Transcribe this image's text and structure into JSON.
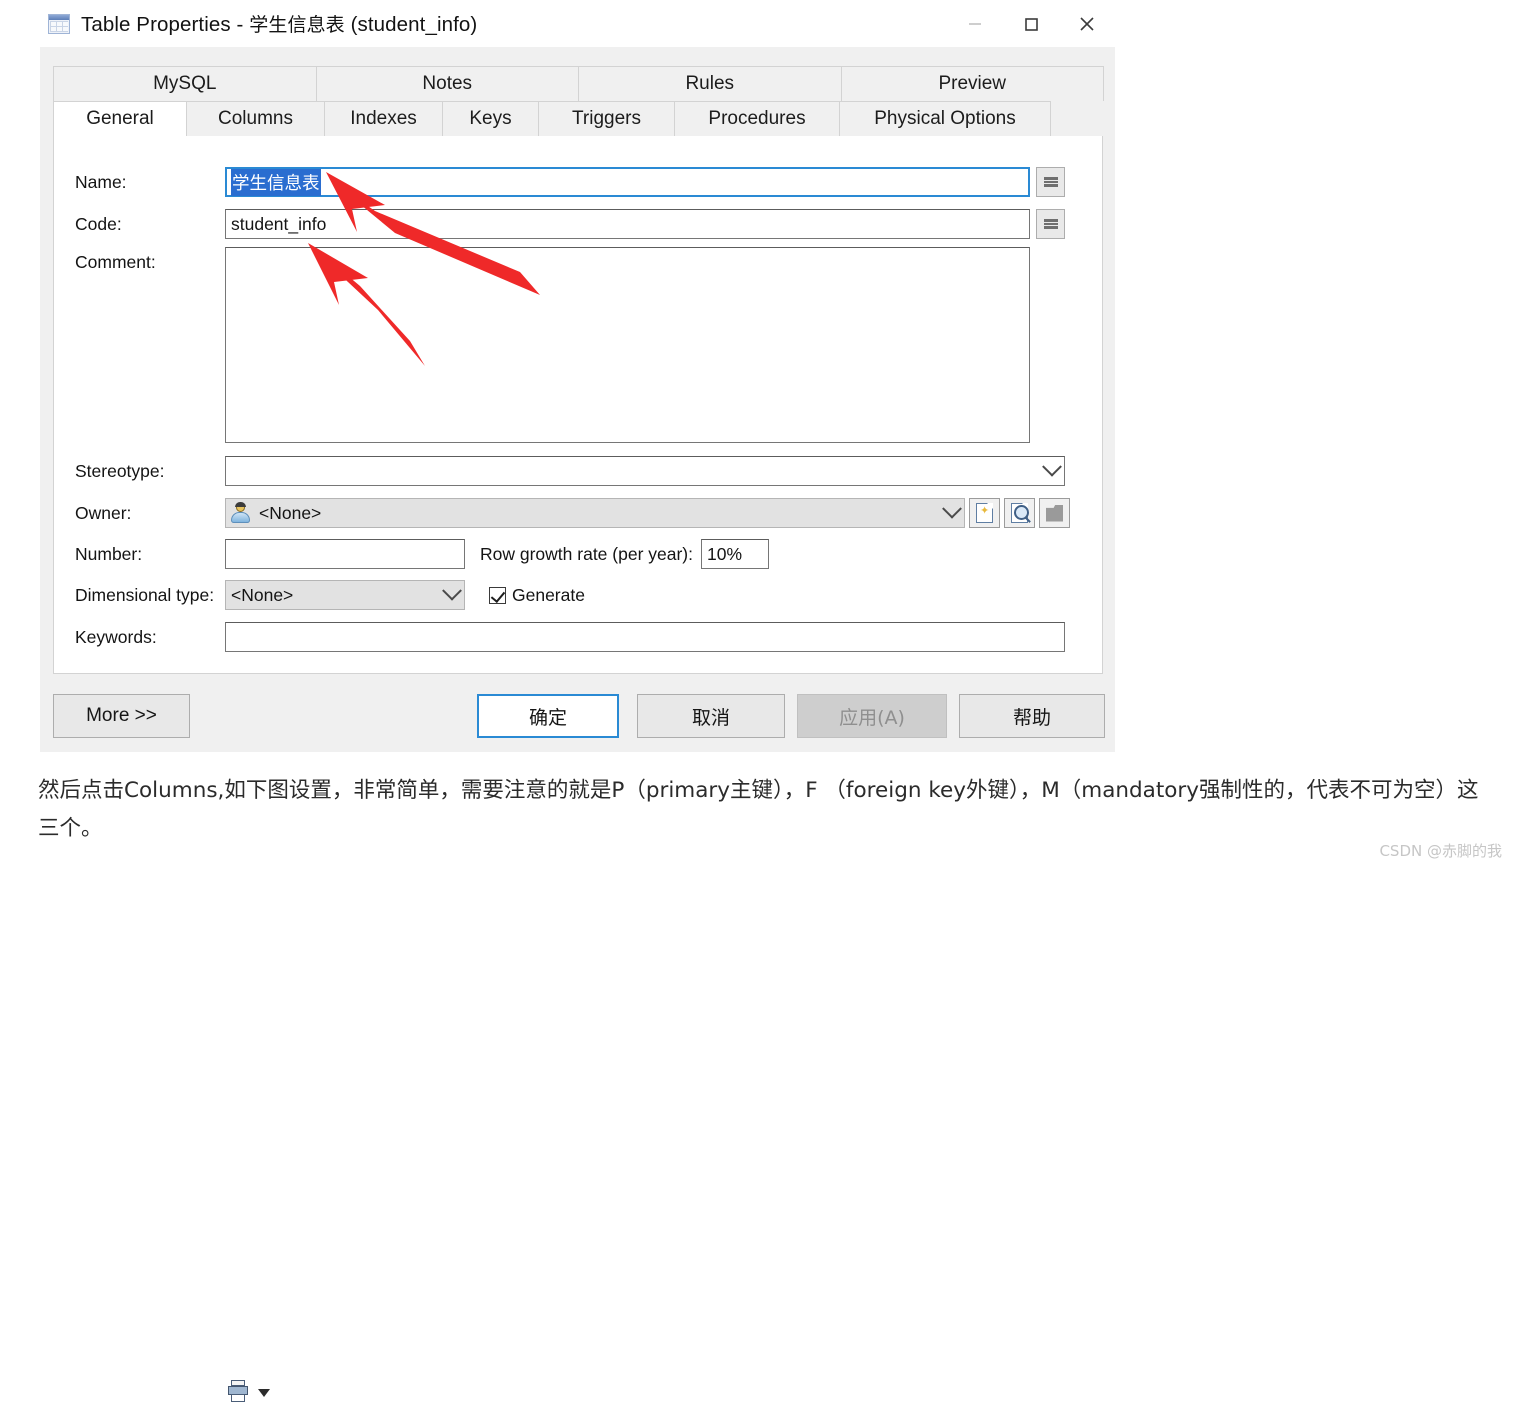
{
  "window": {
    "title_prefix": "Table Properties - ",
    "title_name": "学生信息表",
    "title_code": " (student_info)",
    "icon": "table-grid-icon",
    "controls": {
      "minimize": "minimize-icon",
      "maximize": "maximize-icon",
      "close": "close-icon"
    }
  },
  "tabs": {
    "row1": [
      {
        "label": "MySQL"
      },
      {
        "label": "Notes"
      },
      {
        "label": "Rules"
      },
      {
        "label": "Preview"
      }
    ],
    "row2": [
      {
        "label": "General",
        "active": true
      },
      {
        "label": "Columns"
      },
      {
        "label": "Indexes"
      },
      {
        "label": "Keys"
      },
      {
        "label": "Triggers"
      },
      {
        "label": "Procedures"
      },
      {
        "label": "Physical Options"
      }
    ]
  },
  "form": {
    "name": {
      "label": "Name:",
      "value": "学生信息表",
      "selected": true,
      "button": "properties-button"
    },
    "code": {
      "label": "Code:",
      "value": "student_info",
      "button": "properties-button"
    },
    "comment": {
      "label": "Comment:",
      "value": ""
    },
    "stereotype": {
      "label": "Stereotype:",
      "value": ""
    },
    "owner": {
      "label": "Owner:",
      "value": "<None>",
      "icon": "user-icon",
      "tools": [
        "new-object-icon",
        "find-object-icon",
        "open-object-icon"
      ]
    },
    "number": {
      "label": "Number:",
      "value": ""
    },
    "row_growth": {
      "label": "Row growth rate (per year):",
      "value": "10%"
    },
    "dimensional_type": {
      "label": "Dimensional type:",
      "value": "<None>"
    },
    "generate": {
      "label": "Generate",
      "checked": true
    },
    "keywords": {
      "label": "Keywords:",
      "value": ""
    }
  },
  "footer": {
    "more": "More >>",
    "print_icon": "print-icon",
    "print_caret": "dropdown-caret-icon",
    "ok": "确定",
    "cancel": "取消",
    "apply": "应用(A)",
    "help": "帮助"
  },
  "annotation": {
    "arrow_color": "#ef2929",
    "arrows": 2
  },
  "caption": {
    "text": "然后点击Columns,如下图设置，非常简单，需要注意的就是P（primary主键），F （foreign key外键），M（mandatory强制性的，代表不可为空）这三个。"
  },
  "watermark": {
    "text": "CSDN @赤脚的我"
  }
}
